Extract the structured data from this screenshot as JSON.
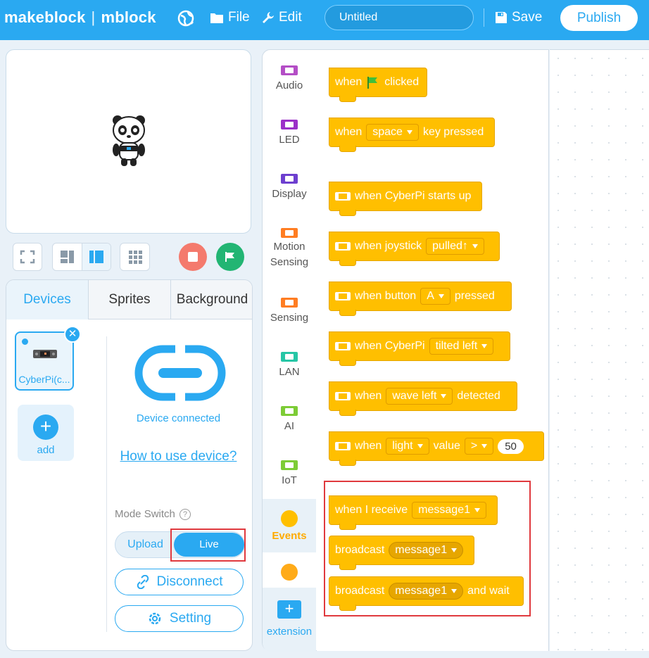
{
  "header": {
    "logo_brand": "makeblock",
    "logo_sep": "|",
    "logo_product": "mblock",
    "file_label": "File",
    "edit_label": "Edit",
    "title_value": "Untitled",
    "save_label": "Save",
    "publish_label": "Publish",
    "colors": {
      "bar": "#2aa9f1"
    }
  },
  "stage_controls": {
    "icons": [
      "fullscreen-icon",
      "small-stage-icon",
      "large-stage-icon",
      "grid-icon",
      "stop-icon",
      "green-flag-icon"
    ]
  },
  "device_panel": {
    "tabs": [
      "Devices",
      "Sprites",
      "Background"
    ],
    "device_name": "CyberPi(c...",
    "add_label": "add",
    "status_text": "Device connected",
    "help_link": "How to use device?",
    "mode_switch_label": "Mode Switch",
    "mode_upload": "Upload",
    "mode_live": "Live",
    "disconnect_label": "Disconnect",
    "setting_label": "Setting"
  },
  "categories": [
    {
      "label": "Audio",
      "color": "#b44ec6"
    },
    {
      "label": "LED",
      "color": "#9b30c8"
    },
    {
      "label": "Display",
      "color": "#6d3fcf"
    },
    {
      "label": "Motion\nSensing",
      "color": "#ff7d22"
    },
    {
      "label": "Sensing",
      "color": "#ff7d22"
    },
    {
      "label": "LAN",
      "color": "#26c6a6"
    },
    {
      "label": "AI",
      "color": "#7dcc36"
    },
    {
      "label": "IoT",
      "color": "#7dcc36"
    },
    {
      "label": "Events",
      "color": "#ffbf00"
    },
    {
      "label": "",
      "color": "#ffab19"
    },
    {
      "label": "extension",
      "color": "#2aa9f1"
    }
  ],
  "blocks": {
    "flag_when": "when",
    "flag_clicked": "clicked",
    "key_when": "when",
    "key_value": "space",
    "key_pressed": "key pressed",
    "startup": "when CyberPi starts up",
    "joystick_prefix": "when joystick",
    "joystick_value": "pulled↑",
    "button_prefix": "when button",
    "button_value": "A",
    "button_suffix": "pressed",
    "tilt_prefix": "when CyberPi",
    "tilt_value": "tilted left",
    "wave_prefix": "when",
    "wave_value": "wave left",
    "wave_suffix": "detected",
    "light_prefix": "when",
    "light_value": "light",
    "light_mid": "value",
    "light_op": ">",
    "light_num": "50",
    "receive_prefix": "when I receive",
    "receive_value": "message1",
    "broadcast_prefix": "broadcast",
    "broadcast_value": "message1",
    "broadcast_wait_prefix": "broadcast",
    "broadcast_wait_value": "message1",
    "broadcast_wait_suffix": "and wait"
  }
}
